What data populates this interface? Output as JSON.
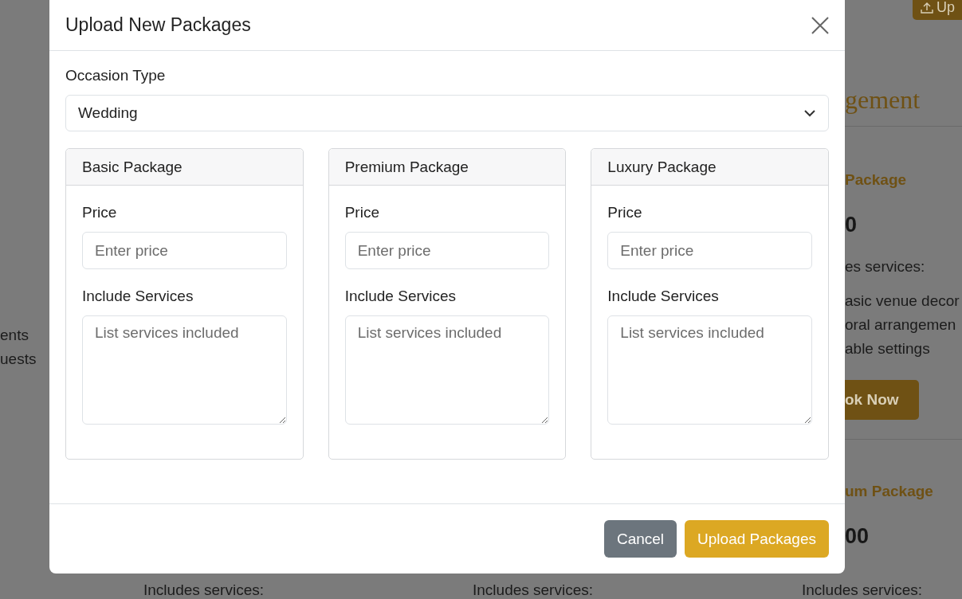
{
  "page": {
    "upload_button": "Up",
    "heading": "gement",
    "cards": [
      {
        "title": "Package",
        "price": "0",
        "services_label": "es services:",
        "services": [
          "asic venue decor",
          "oral arrangemen",
          "able settings"
        ],
        "button": "ok Now"
      },
      {
        "title": "um Package",
        "price": "00"
      }
    ],
    "left_fragments": [
      "ents",
      "uests"
    ],
    "bottom_labels": [
      "Includes services:",
      "Includes services:",
      "Includes services:"
    ]
  },
  "modal": {
    "title": "Upload New Packages",
    "occasion_label": "Occasion Type",
    "occasion_value": "Wedding",
    "packages": [
      {
        "name": "Basic Package",
        "price_label": "Price",
        "price_placeholder": "Enter price",
        "services_label": "Include Services",
        "services_placeholder": "List services included"
      },
      {
        "name": "Premium Package",
        "price_label": "Price",
        "price_placeholder": "Enter price",
        "services_label": "Include Services",
        "services_placeholder": "List services included"
      },
      {
        "name": "Luxury Package",
        "price_label": "Price",
        "price_placeholder": "Enter price",
        "services_label": "Include Services",
        "services_placeholder": "List services included"
      }
    ],
    "buttons": [
      {
        "label": "Cancel",
        "kind": "secondary"
      },
      {
        "label": "Upload Packages",
        "kind": "primary"
      }
    ]
  }
}
